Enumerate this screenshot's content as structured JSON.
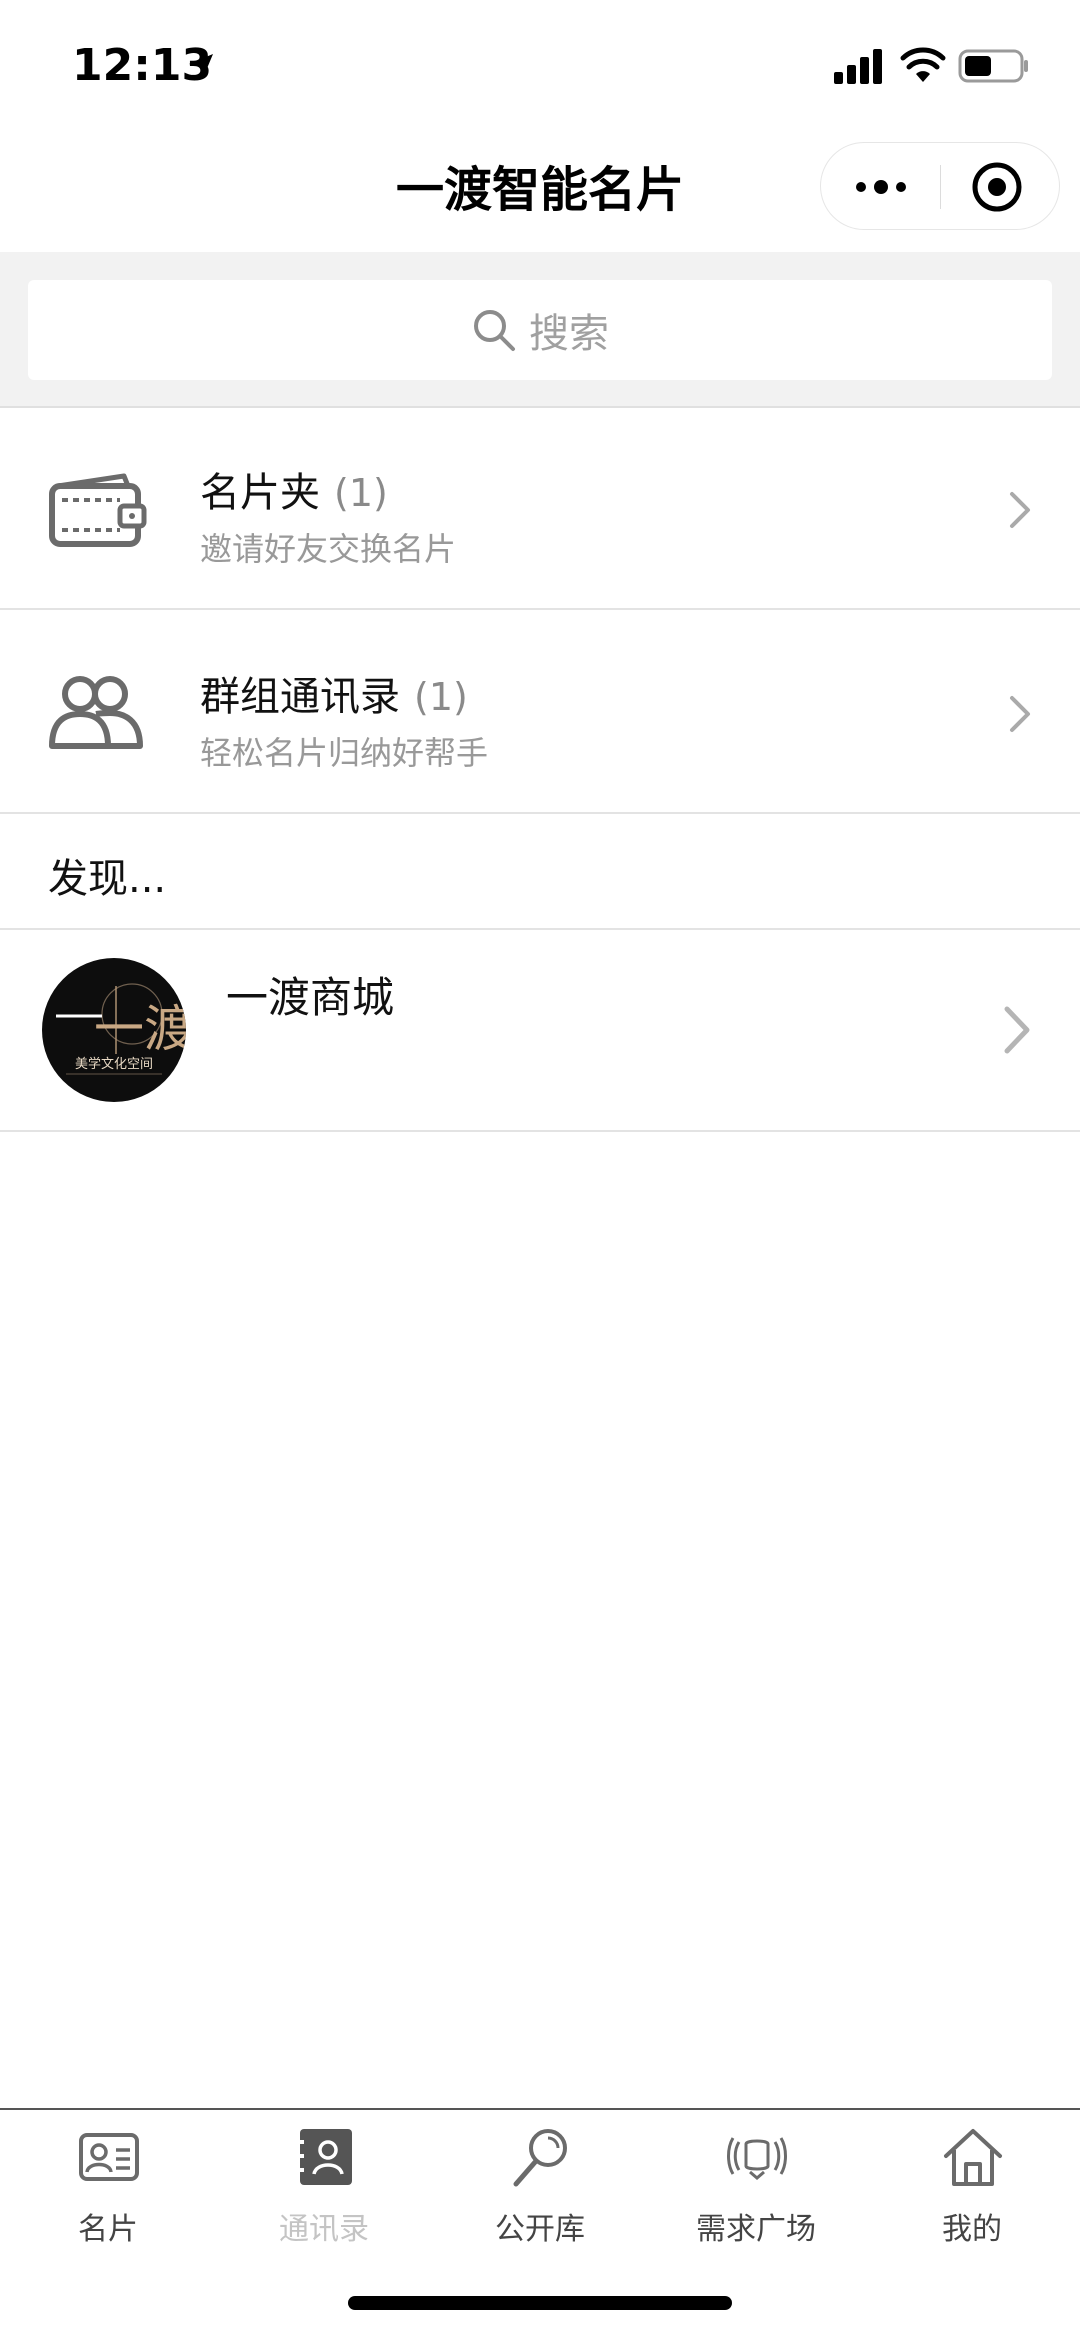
{
  "status_bar": {
    "time": "12:13"
  },
  "nav": {
    "title": "一渡智能名片"
  },
  "search": {
    "placeholder": "搜索"
  },
  "list": [
    {
      "title": "名片夹",
      "count": "(1)",
      "subtitle": "邀请好友交换名片",
      "icon": "wallet-icon"
    },
    {
      "title": "群组通讯录",
      "count": "(1)",
      "subtitle": "轻松名片归纳好帮手",
      "icon": "group-icon"
    }
  ],
  "discover": {
    "header": "发现...",
    "items": [
      {
        "title": "一渡商城",
        "logo_text": "一渡",
        "logo_caption": "美学文化空间"
      }
    ]
  },
  "tabs": [
    {
      "label": "名片",
      "icon": "card-icon"
    },
    {
      "label": "通讯录",
      "icon": "contacts-icon",
      "active": true
    },
    {
      "label": "公开库",
      "icon": "magnifier-icon"
    },
    {
      "label": "需求广场",
      "icon": "broadcast-icon"
    },
    {
      "label": "我的",
      "icon": "home-icon"
    }
  ],
  "colors": {
    "active_tab": "#c4c4c4",
    "inactive_tab": "#444444",
    "icon_gray": "#6b6b6b"
  }
}
